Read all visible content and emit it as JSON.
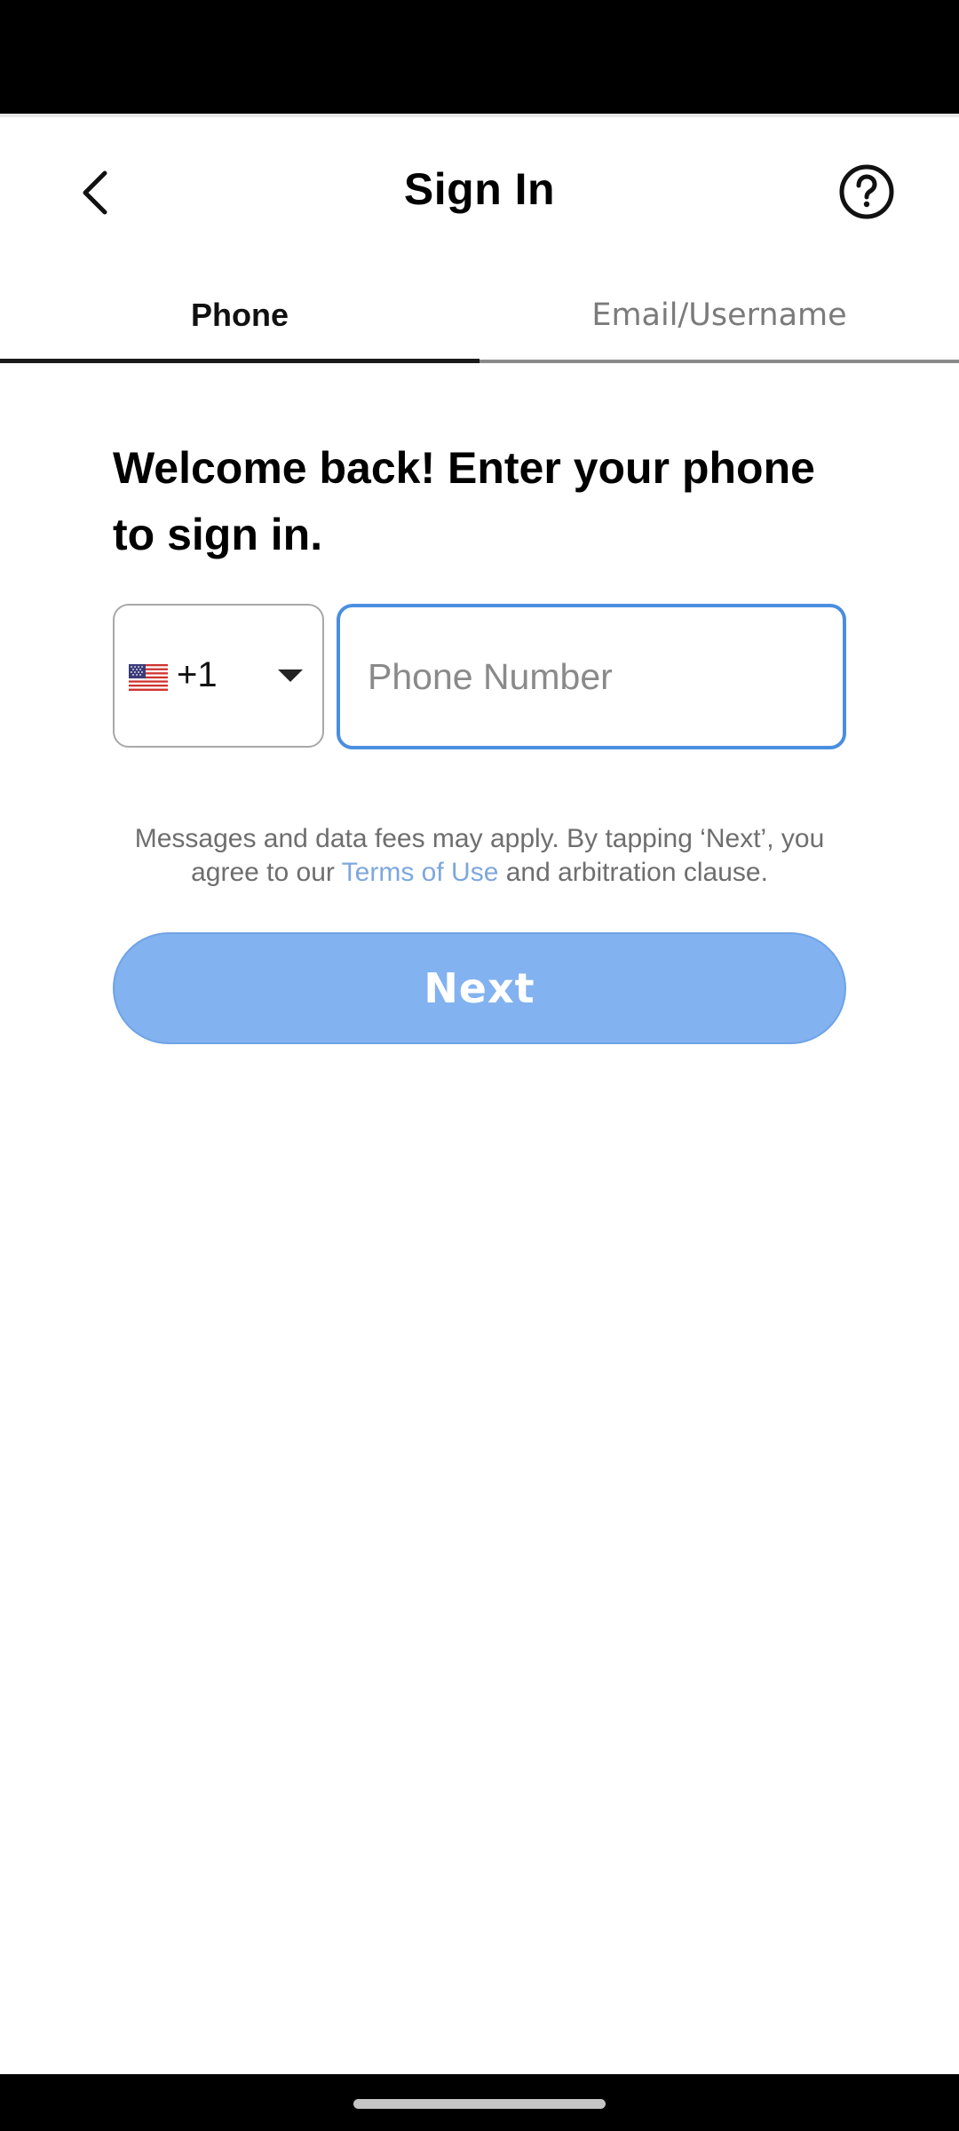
{
  "header": {
    "title": "Sign In",
    "back_icon": "chevron-left-icon",
    "help_icon": "help-circle-icon"
  },
  "tabs": [
    {
      "label": "Phone",
      "active": true
    },
    {
      "label": "Email/Username",
      "active": false
    }
  ],
  "form": {
    "welcome_text": "Welcome back! Enter your phone to sign in.",
    "country": {
      "flag_icon": "us-flag-icon",
      "code": "+1"
    },
    "phone": {
      "value": "",
      "placeholder": "Phone Number"
    },
    "disclaimer": {
      "before": "Messages and data fees may apply. By tapping ‘Next’,  you agree to our ",
      "link": "Terms of Use",
      "after": " and arbitration clause."
    },
    "next_label": "Next"
  },
  "colors": {
    "accent": "#4a8ee0",
    "button_disabled": "#82b2ef",
    "link": "#7ea7dc"
  }
}
